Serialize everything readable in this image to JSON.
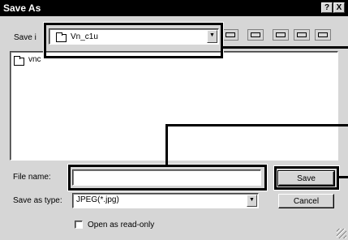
{
  "window": {
    "title": "Save As",
    "help_button": "?",
    "close_button": "X"
  },
  "save_in": {
    "label": "Save in:",
    "label_visible": "Save i",
    "value": "Vn_c1u",
    "icon": "folder-icon"
  },
  "toolbar": {
    "icons": [
      "up-one-level-icon",
      "new-folder-icon",
      "desktop-icon",
      "list-view-icon",
      "details-view-icon"
    ]
  },
  "file_list": {
    "items": [
      {
        "name": "vnctemp",
        "visible_name": "vnc",
        "icon": "folder-icon"
      }
    ]
  },
  "file_name": {
    "label": "File name:",
    "value": "",
    "save_button": "Save"
  },
  "save_as_type": {
    "label": "Save as type:",
    "value": "JPEG(*.jpg)",
    "cancel_button": "Cancel"
  },
  "read_only": {
    "label": "Open as read-only",
    "checked": false
  },
  "colors": {
    "title_bar": "#000000",
    "dialog_face": "#d6d6d6",
    "callout": "#000000"
  }
}
